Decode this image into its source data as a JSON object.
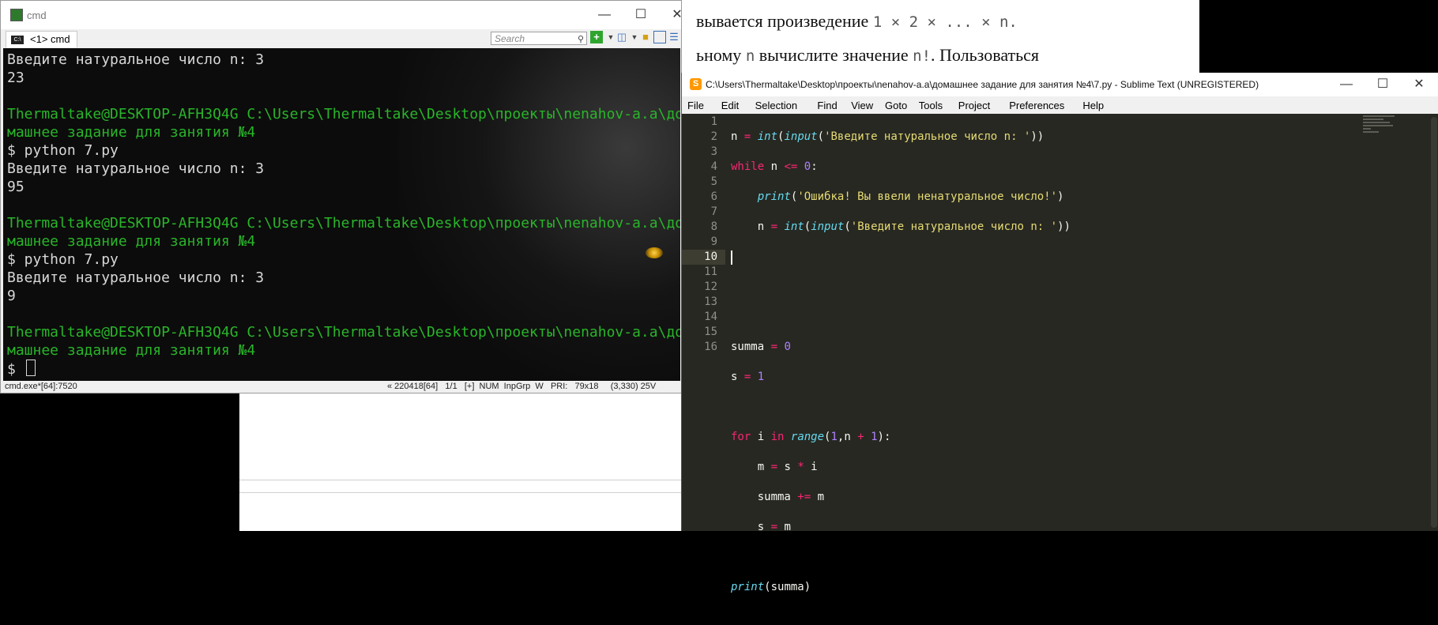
{
  "background_doc": {
    "line1_text": "вывается произведение",
    "line1_math": "1 × 2 × ... × n.",
    "line2_text_a": "ьному",
    "line2_math_n": "n",
    "line2_text_b": "вычислите значение",
    "line2_math_fact": "n!",
    "line2_text_c": ". Пользоваться"
  },
  "cmd": {
    "title": "cmd",
    "tab_label": "<1> cmd",
    "search_placeholder": "Search",
    "lines": [
      {
        "cls": "w",
        "text": "Введите натуральное число n: 3"
      },
      {
        "cls": "w",
        "text": "23"
      },
      {
        "cls": "w",
        "text": ""
      },
      {
        "cls": "g",
        "text": "Thermaltake@DESKTOP-AFH3Q4G C:\\Users\\Thermaltake\\Desktop\\проекты\\nenahov-a.a\\до"
      },
      {
        "cls": "g",
        "text": "машнее задание для занятия №4"
      },
      {
        "cls": "w",
        "text": "$ python 7.py"
      },
      {
        "cls": "w",
        "text": "Введите натуральное число n: 3"
      },
      {
        "cls": "w",
        "text": "95"
      },
      {
        "cls": "w",
        "text": ""
      },
      {
        "cls": "g",
        "text": "Thermaltake@DESKTOP-AFH3Q4G C:\\Users\\Thermaltake\\Desktop\\проекты\\nenahov-a.a\\до"
      },
      {
        "cls": "g",
        "text": "машнее задание для занятия №4"
      },
      {
        "cls": "w",
        "text": "$ python 7.py"
      },
      {
        "cls": "w",
        "text": "Введите натуральное число n: 3"
      },
      {
        "cls": "w",
        "text": "9"
      },
      {
        "cls": "w",
        "text": ""
      },
      {
        "cls": "g",
        "text": "Thermaltake@DESKTOP-AFH3Q4G C:\\Users\\Thermaltake\\Desktop\\проекты\\nenahov-a.a\\до"
      },
      {
        "cls": "g",
        "text": "машнее задание для занятия №4"
      }
    ],
    "prompt": "$ ",
    "status_left": "cmd.exe*[64]:7520",
    "status_right": "« 220418[64]   1/1   [+]  NUM  InpGrp  W   PRI:   79x18     (3,330) 25V"
  },
  "sublime": {
    "title": "C:\\Users\\Thermaltake\\Desktop\\проекты\\nenahov-a.a\\домашнее задание для занятия №4\\7.py - Sublime Text (UNREGISTERED)",
    "menu": [
      "File",
      "Edit",
      "Selection",
      "Find",
      "View",
      "Goto",
      "Tools",
      "Project",
      "Preferences",
      "Help"
    ],
    "line_numbers": [
      "1",
      "2",
      "3",
      "4",
      "5",
      "6",
      "7",
      "8",
      "9",
      "10",
      "11",
      "12",
      "13",
      "14",
      "15",
      "16"
    ],
    "active_line": 10
  },
  "colors": {
    "cmd_green": "#29b529",
    "sublime_bg": "#272822",
    "keyword": "#f92672",
    "string": "#e6db74",
    "number": "#ae81ff",
    "function": "#66d9ef"
  }
}
